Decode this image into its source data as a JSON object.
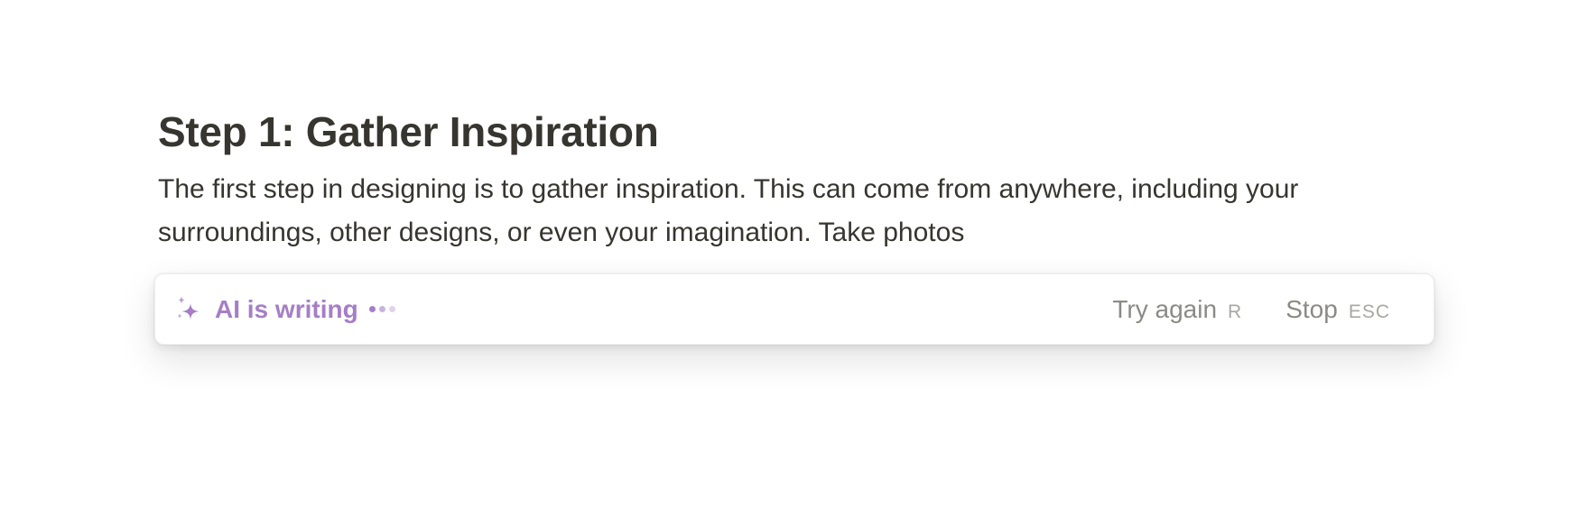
{
  "document": {
    "heading": "Step 1: Gather Inspiration",
    "paragraph": "The first step in designing is to gather inspiration. This can come from anywhere, including your surroundings, other designs, or even your imagination. Take photos"
  },
  "ai_bar": {
    "status": "AI is writing",
    "status_icon": "sparkle-icon",
    "loading_indicator": "loading-dots",
    "accent_color": "#a57ec7",
    "actions": [
      {
        "label": "Try again",
        "shortcut": "R"
      },
      {
        "label": "Stop",
        "shortcut": "ESC"
      }
    ]
  }
}
